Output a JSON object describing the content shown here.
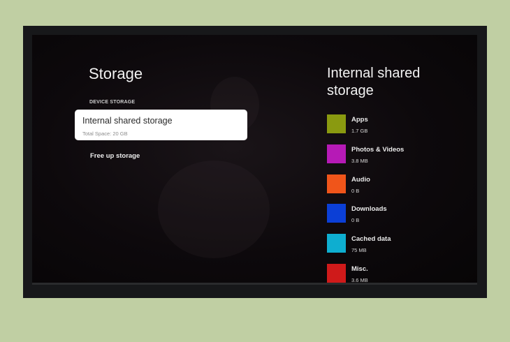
{
  "left_panel": {
    "title": "Storage",
    "section_label": "DEVICE STORAGE",
    "storage_card": {
      "title": "Internal shared storage",
      "subtitle": "Total Space: 20 GB"
    },
    "free_up_label": "Free up storage"
  },
  "right_panel": {
    "title": "Internal shared storage",
    "categories": [
      {
        "name": "Apps",
        "size": "1.7 GB",
        "color": "#8a9a10"
      },
      {
        "name": "Photos & Videos",
        "size": "3.8 MB",
        "color": "#b61ab6"
      },
      {
        "name": "Audio",
        "size": "0 B",
        "color": "#f0551a"
      },
      {
        "name": "Downloads",
        "size": "0 B",
        "color": "#0b3fd6"
      },
      {
        "name": "Cached data",
        "size": "75 MB",
        "color": "#0eaed0"
      },
      {
        "name": "Misc.",
        "size": "3.6 MB",
        "color": "#cf1a1a"
      }
    ]
  }
}
